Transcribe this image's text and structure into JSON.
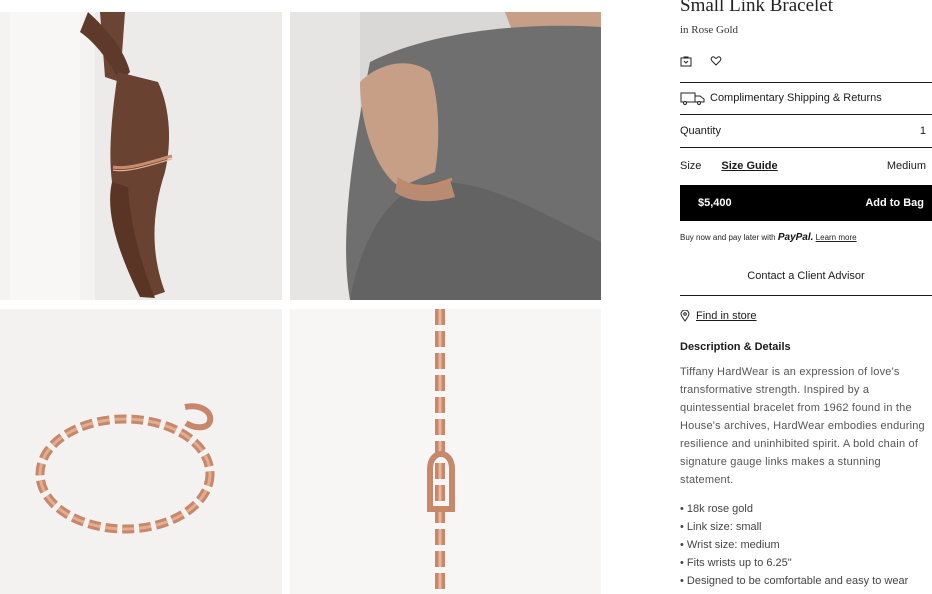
{
  "product": {
    "title": "Small Link Bracelet",
    "material": "in Rose Gold"
  },
  "icons": [
    "bag-save-icon",
    "heart-icon"
  ],
  "shipping": {
    "label": "Complimentary Shipping & Returns"
  },
  "quantity": {
    "label": "Quantity",
    "value": "1"
  },
  "size": {
    "label": "Size",
    "guide_label": "Size Guide",
    "value": "Medium"
  },
  "buy": {
    "price": "$5,400",
    "button_label": "Add to Bag",
    "color": "#000000"
  },
  "paypal": {
    "prefix": "Buy now and pay later with",
    "brand": "PayPal.",
    "link": "Learn more"
  },
  "contact": {
    "label": "Contact a Client Advisor"
  },
  "store": {
    "label": "Find in store"
  },
  "description": {
    "heading": "Description & Details",
    "text": "Tiffany HardWear is an expression of love's transformative strength. Inspired by a quintessential bracelet from 1962 found in the House's archives, HardWear embodies enduring resilience and uninhibited spirit. A bold chain of signature gauge links makes a stunning statement.",
    "bullets": [
      "• 18k rose gold",
      "• Link size: small",
      "• Wrist size: medium",
      "• Fits wrists up to 6.25\"",
      "• Designed to be comfortable and easy to wear"
    ]
  },
  "images": [
    "product-photo-wrist-woman",
    "product-photo-wrist-man",
    "product-photo-bracelet-flat",
    "product-photo-chain-vertical"
  ]
}
